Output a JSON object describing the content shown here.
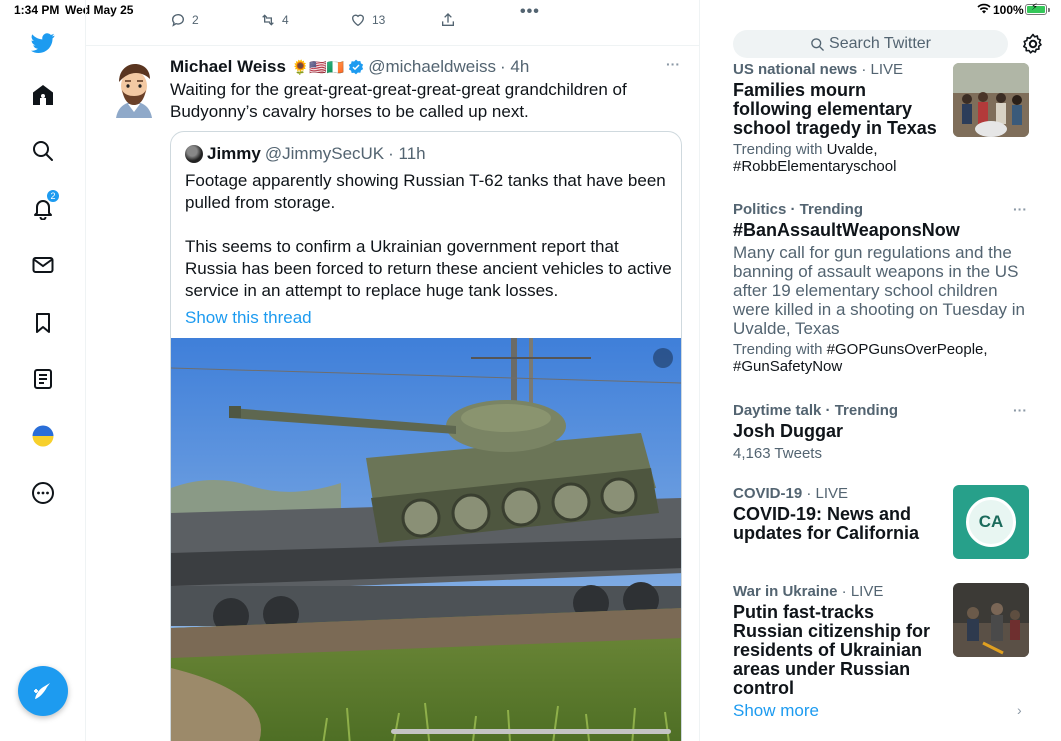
{
  "status_bar": {
    "time": "1:34 PM",
    "date": "Wed May 25",
    "battery": "100%"
  },
  "nav": {
    "notifications_badge": "2",
    "icons": [
      "twitter-logo-icon",
      "home-icon",
      "search-icon",
      "bell-icon",
      "mail-icon",
      "bookmark-icon",
      "lists-icon",
      "ukraine-flag-icon",
      "more-icon",
      "compose-icon"
    ],
    "accent": "#1d9bf0"
  },
  "prev_tweet": {
    "replies": "2",
    "retweets": "4",
    "likes": "13"
  },
  "tweet": {
    "name": "Michael Weiss",
    "emojis": "🌻🇺🇸🇮🇪",
    "handle": "@michaeldweiss",
    "time": "· 4h",
    "text": "Waiting for the great-great-great-great-great grandchildren of Budyonny’s cavalry horses to be called up next.",
    "quote": {
      "name": "Jimmy",
      "handle": "@JimmySecUK",
      "time": "· 11h",
      "text1": "Footage apparently showing Russian T-62 tanks that have been pulled from storage.",
      "text2": "This seems to confirm a Ukrainian government report that Russia has been forced to return these ancient vehicles to active service in an attempt to replace huge tank losses.",
      "show_thread": "Show this thread"
    }
  },
  "sidebar": {
    "search_placeholder": "Search Twitter",
    "trends": [
      {
        "category": "US national news",
        "tag": "· LIVE",
        "title": "Families mourn following elementary school tragedy in Texas",
        "with_label": "Trending with ",
        "with_tags": "Uvalde, #RobbElementaryschool"
      },
      {
        "category": "Politics · Trending",
        "title": "#BanAssaultWeaponsNow",
        "desc": "Many call for gun regulations and the banning of assault weapons in the US after 19 elementary school children were killed in a shooting on Tuesday in Uvalde, Texas",
        "with_label": "Trending with ",
        "with_tags": "#GOPGunsOverPeople, #GunSafetyNow"
      },
      {
        "category": "Daytime talk · Trending",
        "title": "Josh Duggar",
        "count": "4,163 Tweets"
      },
      {
        "category": "COVID-19",
        "tag": "· LIVE",
        "title": "COVID-19: News and updates for California",
        "thumb_text": "CA"
      },
      {
        "category": "War in Ukraine",
        "tag": "· LIVE",
        "title": "Putin fast-tracks Russian citizenship for residents of Ukrainian areas under Russian control"
      }
    ],
    "show_more": "Show more"
  }
}
